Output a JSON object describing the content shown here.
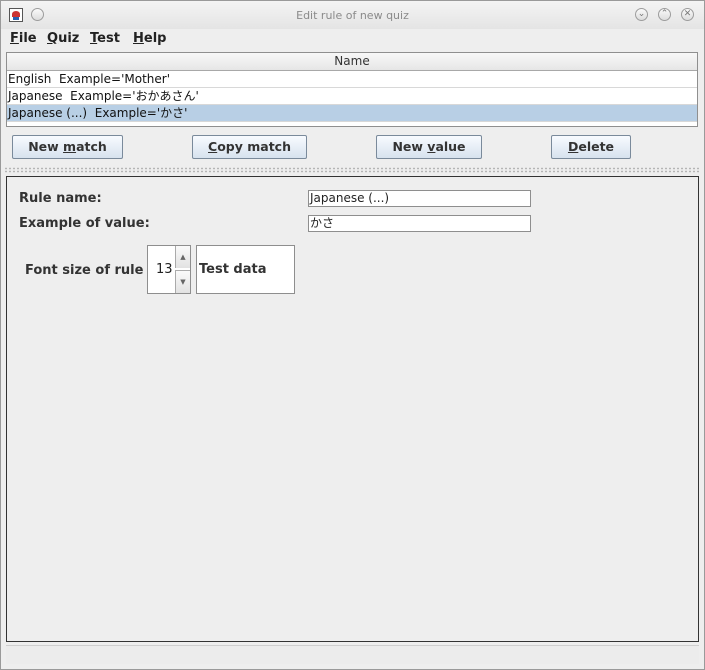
{
  "window": {
    "title": "Edit rule of new quiz"
  },
  "menu": [
    {
      "accel": "F",
      "rest": "ile"
    },
    {
      "accel": "Q",
      "rest": "uiz"
    },
    {
      "accel": "T",
      "rest": "est"
    },
    {
      "accel": "H",
      "rest": "elp"
    }
  ],
  "table": {
    "column_header": "Name",
    "rows": [
      "English  Example='Mother'",
      "Japanese  Example='おかあさん'",
      "Japanese (...)  Example='かさ'"
    ],
    "selected_index": 2
  },
  "buttons": {
    "new_match": {
      "pre": "New ",
      "accel": "m",
      "post": "atch"
    },
    "copy_match": {
      "pre": "",
      "accel": "C",
      "post": "opy match"
    },
    "new_value": {
      "pre": "New ",
      "accel": "v",
      "post": "alue"
    },
    "delete": {
      "pre": "",
      "accel": "D",
      "post": "elete"
    }
  },
  "form": {
    "rule_name_label": "Rule name:",
    "rule_name_value": "Japanese (...)",
    "example_label": "Example of value:",
    "example_value": "かさ",
    "font_size_label": "Font size of rule",
    "font_size_value": "13",
    "test_data": "Test data"
  },
  "icons": {
    "app": "java-app-icon",
    "minimize": "minimize-icon",
    "maximize": "maximize-icon",
    "close": "close-icon",
    "up": "arrow-up-icon",
    "down": "arrow-down-icon"
  }
}
